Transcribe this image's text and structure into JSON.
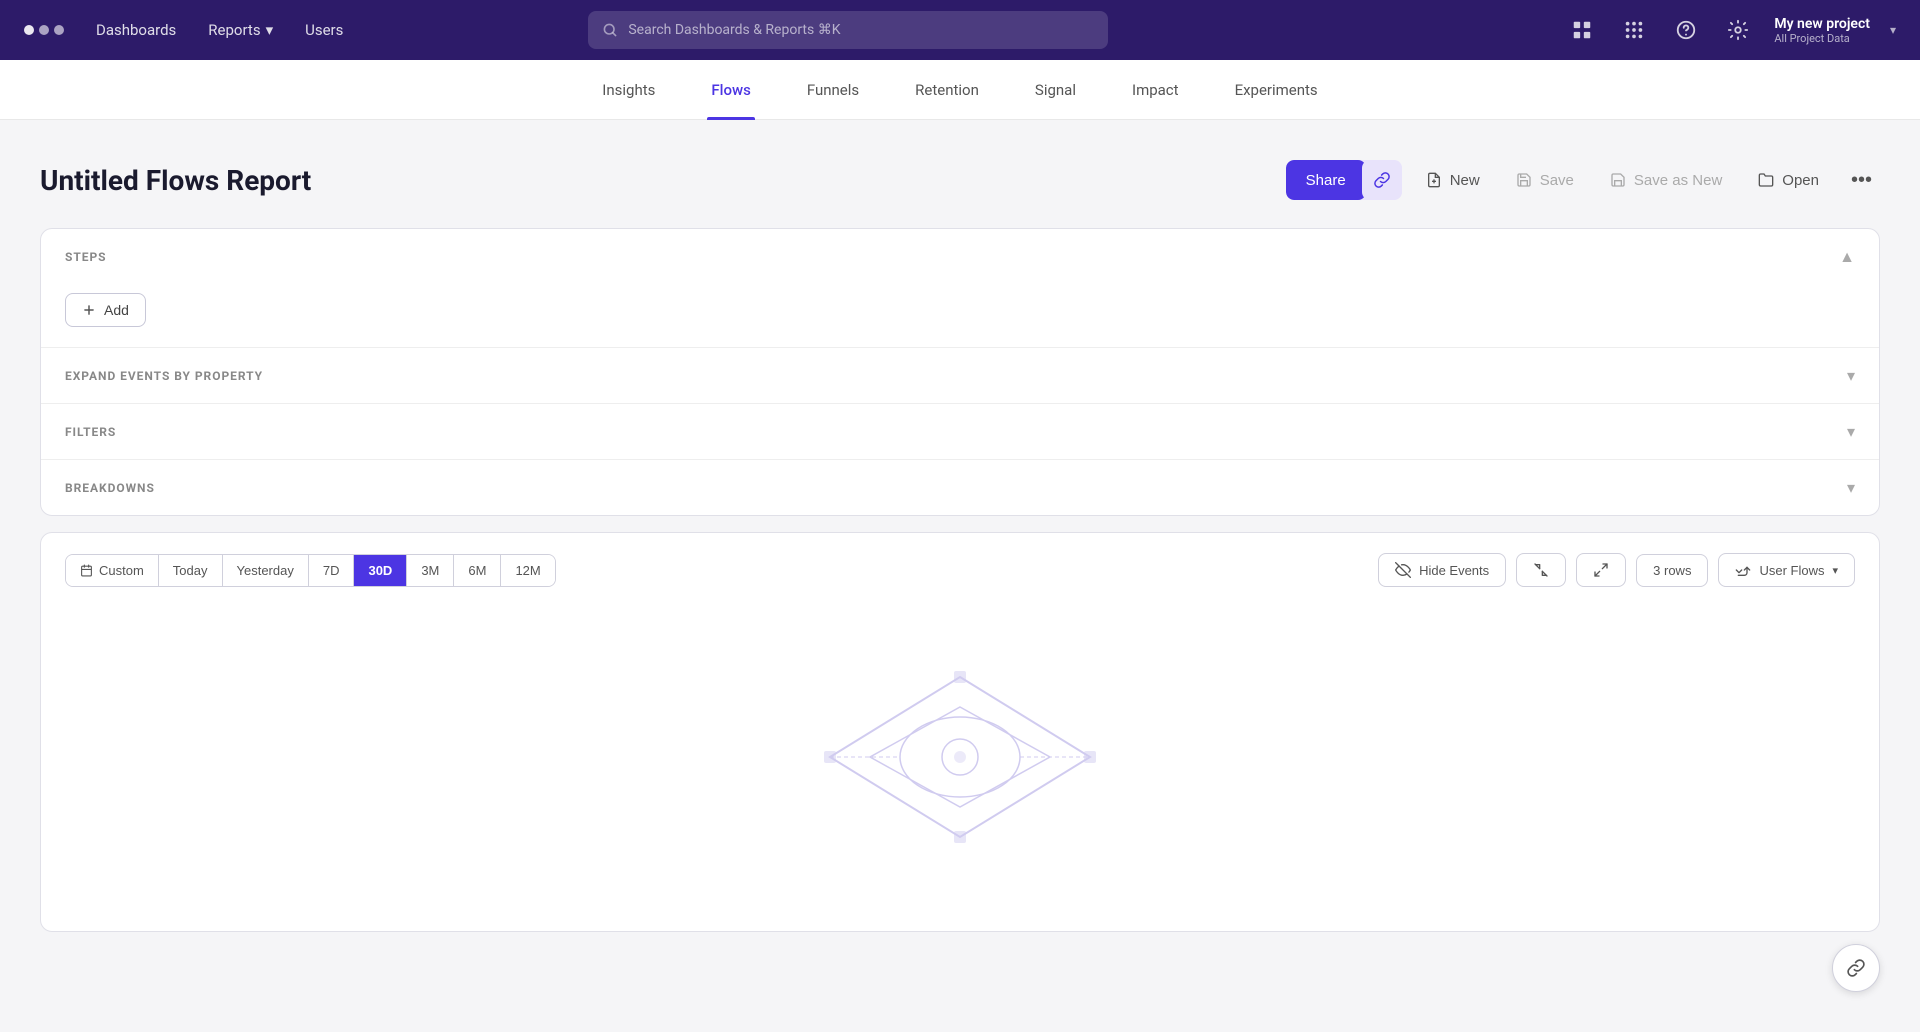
{
  "nav": {
    "dots": [
      "dot1",
      "dot2",
      "dot3"
    ],
    "items": [
      {
        "label": "Dashboards",
        "hasDropdown": false
      },
      {
        "label": "Reports",
        "hasDropdown": true
      },
      {
        "label": "Users",
        "hasDropdown": false
      }
    ],
    "search_placeholder": "Search Dashboards & Reports ⌘K",
    "project_name": "My new project",
    "project_sub": "All Project Data"
  },
  "tabs": [
    {
      "label": "Insights",
      "active": false
    },
    {
      "label": "Flows",
      "active": true
    },
    {
      "label": "Funnels",
      "active": false
    },
    {
      "label": "Retention",
      "active": false
    },
    {
      "label": "Signal",
      "active": false
    },
    {
      "label": "Impact",
      "active": false
    },
    {
      "label": "Experiments",
      "active": false
    }
  ],
  "report": {
    "title": "Untitled Flows Report",
    "actions": {
      "share_label": "Share",
      "new_label": "New",
      "save_label": "Save",
      "save_as_new_label": "Save as New",
      "open_label": "Open"
    }
  },
  "sections": [
    {
      "id": "steps",
      "label": "STEPS",
      "collapsed": false,
      "add_label": "Add"
    },
    {
      "id": "expand",
      "label": "EXPAND EVENTS BY PROPERTY",
      "collapsed": true
    },
    {
      "id": "filters",
      "label": "FILTERS",
      "collapsed": true
    },
    {
      "id": "breakdowns",
      "label": "BREAKDOWNS",
      "collapsed": true
    }
  ],
  "bottom_toolbar": {
    "date_options": [
      {
        "label": "Custom",
        "active": false,
        "hasIcon": true
      },
      {
        "label": "Today",
        "active": false
      },
      {
        "label": "Yesterday",
        "active": false
      },
      {
        "label": "7D",
        "active": false
      },
      {
        "label": "30D",
        "active": true
      },
      {
        "label": "3M",
        "active": false
      },
      {
        "label": "6M",
        "active": false
      },
      {
        "label": "12M",
        "active": false
      }
    ],
    "hide_events_label": "Hide Events",
    "rows_label": "3 rows",
    "user_flows_label": "User Flows"
  },
  "icons": {
    "search": "🔍",
    "apps": "⊞",
    "help": "?",
    "settings": "⚙",
    "share_link": "🔗",
    "chevron_down": "▾",
    "chevron_up": "▴",
    "plus": "+",
    "calendar": "📅",
    "eye_slash": "👁",
    "arrows_in": "↔",
    "arrows_out": "↔",
    "chart": "📊",
    "link_float": "🔗",
    "new_doc": "📄",
    "save_doc": "💾",
    "open_folder": "📂"
  }
}
